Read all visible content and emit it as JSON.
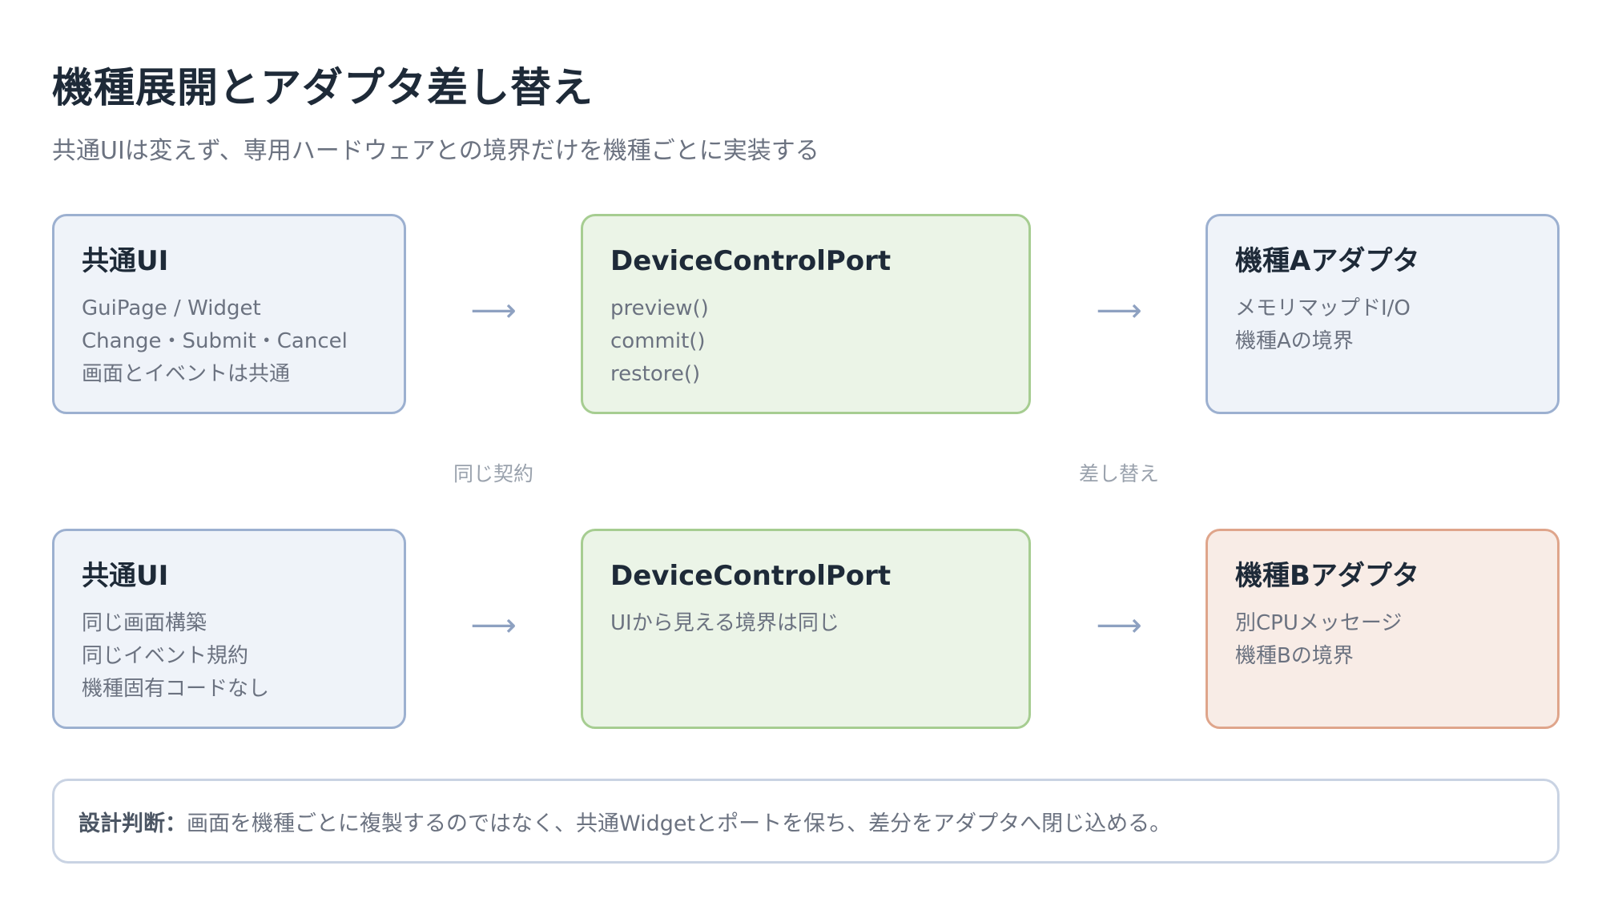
{
  "title": "機種展開とアダプタ差し替え",
  "subtitle": "共通UIは変えず、専用ハードウェアとの境界だけを機種ごとに実装する",
  "rows": [
    {
      "ui": {
        "title": "共通UI",
        "lines": [
          "GuiPage / Widget",
          "Change・Submit・Cancel",
          "画面とイベントは共通"
        ]
      },
      "port": {
        "title": "DeviceControlPort",
        "lines": [
          "preview()",
          "commit()",
          "restore()"
        ]
      },
      "adapter": {
        "title": "機種Aアダプタ",
        "lines": [
          "メモリマップドI/O",
          "機種Aの境界"
        ]
      }
    },
    {
      "ui": {
        "title": "共通UI",
        "lines": [
          "同じ画面構築",
          "同じイベント規約",
          "機種固有コードなし"
        ]
      },
      "port": {
        "title": "DeviceControlPort",
        "lines": [
          "UIから見える境界は同じ"
        ]
      },
      "adapter": {
        "title": "機種Bアダプタ",
        "lines": [
          "別CPUメッセージ",
          "機種Bの境界"
        ]
      }
    }
  ],
  "arrow_glyph": "⟶",
  "mid_labels": {
    "left": "同じ契約",
    "right": "差し替え"
  },
  "note": {
    "label": "設計判断：",
    "text": "画面を機種ごとに複製するのではなく、共通Widgetとポートを保ち、差分をアダプタへ閉じ込める。"
  },
  "colors": {
    "ui_fill": "#eff3f9",
    "ui_border": "#9cb0d0",
    "port_fill": "#ebf4e7",
    "port_border": "#a6cd91",
    "adapter_b_fill": "#f8ece6",
    "adapter_b_border": "#dfa58b"
  }
}
